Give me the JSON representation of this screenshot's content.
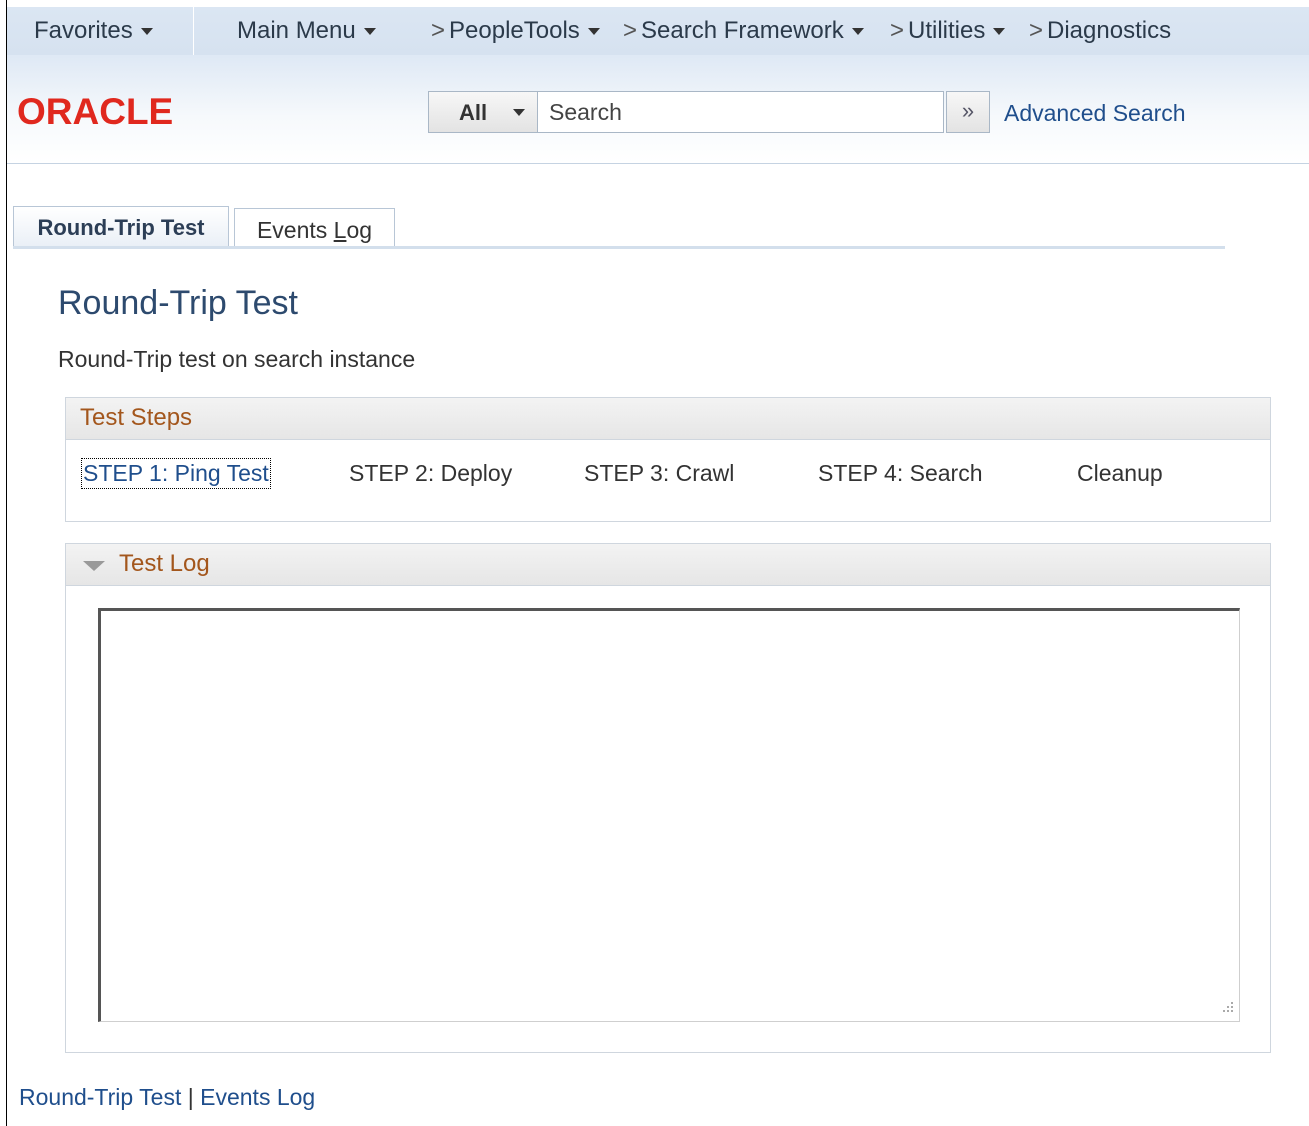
{
  "nav": {
    "favorites": "Favorites",
    "main_menu": "Main Menu",
    "breadcrumb": [
      "PeopleTools",
      "Search Framework",
      "Utilities",
      "Diagnostics"
    ]
  },
  "logo_text": "ORACLE",
  "search": {
    "scope": "All",
    "placeholder": "Search",
    "go_icon": "double-chevron-right-icon",
    "advanced_label": "Advanced Search"
  },
  "tabs": [
    {
      "label": "Round-Trip Test",
      "active": true
    },
    {
      "label_prefix": "Events ",
      "label_access": "L",
      "label_suffix": "og",
      "active": false
    }
  ],
  "page": {
    "title": "Round-Trip Test",
    "description": "Round-Trip test on search instance"
  },
  "test_steps": {
    "title": "Test Steps",
    "steps": [
      "STEP 1: Ping Test",
      "STEP 2: Deploy",
      "STEP 3: Crawl",
      "STEP 4: Search",
      "Cleanup"
    ]
  },
  "test_log": {
    "title": "Test Log",
    "content": ""
  },
  "footer": {
    "links": [
      "Round-Trip Test",
      "Events Log"
    ],
    "separator": "|"
  },
  "colors": {
    "link": "#1f4e8c",
    "group_title": "#a3561c",
    "page_title": "#2d4a6e",
    "logo": "#e0281e"
  }
}
